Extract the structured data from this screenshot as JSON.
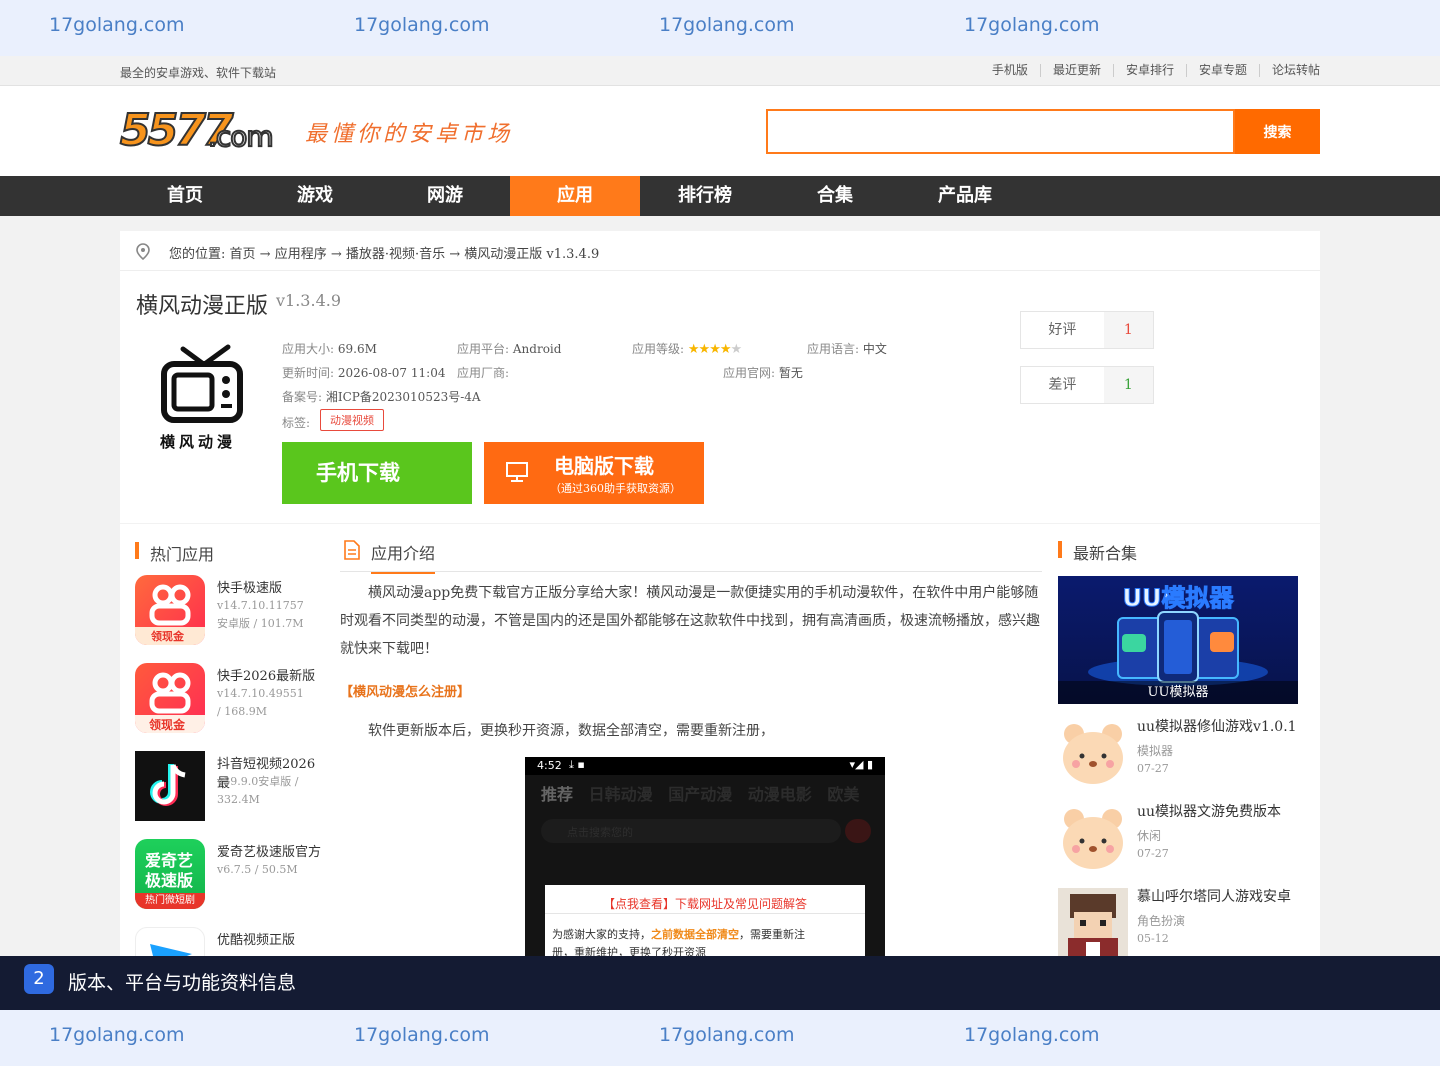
{
  "watermark": {
    "text": "17golang.com"
  },
  "topbar": {
    "slogan": "最全的安卓游戏、软件下载站",
    "links": [
      "手机版",
      "最近更新",
      "安卓排行",
      "安卓专题",
      "论坛转帖"
    ]
  },
  "header": {
    "logo_main": "5577",
    "logo_com": ".com",
    "motto": "最懂你的安卓市场",
    "search_button": "搜索",
    "search_value": ""
  },
  "nav": {
    "items": [
      "首页",
      "游戏",
      "网游",
      "应用",
      "排行榜",
      "合集",
      "产品库"
    ],
    "active": "应用"
  },
  "breadcrumb": {
    "prefix": "您的位置:",
    "path": "首页 → 应用程序 → 播放器·视频·音乐 → 横风动漫正版 v1.3.4.9"
  },
  "app": {
    "title": "横风动漫正版",
    "version": "v1.3.4.9",
    "icon_caption": "横风动漫",
    "size_label": "应用大小:",
    "size": "69.6M",
    "platform_label": "应用平台:",
    "platform": "Android",
    "rating_label": "应用等级:",
    "rating_stars": 4,
    "rating_max": 5,
    "language_label": "应用语言:",
    "language": "中文",
    "updated_label": "更新时间:",
    "updated": "2026-08-07 11:04",
    "vendor_label": "应用厂商:",
    "vendor": "",
    "site_label": "应用官网:",
    "site": "暂无",
    "icp_label": "备案号:",
    "icp": "湘ICP备2023010523号-4A",
    "tags_label": "标签:",
    "tag": "动漫视频"
  },
  "buttons": {
    "phone": "手机下载",
    "pc": "电脑版下载",
    "pc_sub": "（通过360助手获取资源）"
  },
  "votes": {
    "good_label": "好评",
    "good": "1",
    "bad_label": "差评",
    "bad": "1"
  },
  "hot": {
    "title": "热门应用",
    "items": [
      {
        "name": "快手极速版",
        "meta": "v14.7.10.11757安卓版 / 101.7M",
        "badge": "领现金"
      },
      {
        "name": "快手2026最新版",
        "meta": "v14.7.10.49551 / 168.9M",
        "badge": "领现金"
      },
      {
        "name": "抖音短视频2026最",
        "meta": "v39.9.0安卓版 / 332.4M"
      },
      {
        "name": "爱奇艺极速版官方",
        "meta": "v6.7.5 / 50.5M",
        "icon_top": "爱奇艺",
        "icon_mid": "极速版",
        "badge": "热门微短剧"
      },
      {
        "name": "优酷视频正版",
        "meta": ""
      }
    ]
  },
  "intro": {
    "title": "应用介绍",
    "para1": "横风动漫app免费下载官方正版分享给大家！横风动漫是一款便捷实用的手机动漫软件，在软件中用户能够随时观看不同类型的动漫，不管是国内的还是国外都能够在这款软件中找到，拥有高清画质，极速流畅播放，感兴趣就快来下载吧！",
    "subhead": "【横风动漫怎么注册】",
    "para2": "软件更新版本后，更换秒开资源，数据全部清空，需要重新注册，",
    "shot": {
      "time": "4:52",
      "tabs": [
        "推荐",
        "日韩动漫",
        "国产动漫",
        "动漫电影",
        "欧美"
      ],
      "search_hint": "点击搜索您的",
      "dialog_title_a": "【点我查看】",
      "dialog_title_b": "下载网址及常见问题解答",
      "dialog_text_a": "为感谢大家的支持，",
      "dialog_text_b": "之前数据全部清空",
      "dialog_text_c": "，需要重新注",
      "dialog_text_d": "册，重新维护，更换了秒开资源"
    }
  },
  "collections": {
    "title": "最新合集",
    "cover_title": "UU模拟器",
    "cover_caption": "UU模拟器",
    "items": [
      {
        "name": "uu模拟器修仙游戏v1.0.1",
        "cat": "模拟器",
        "date": "07-27"
      },
      {
        "name": "uu模拟器文游免费版本",
        "cat": "休闲",
        "date": "07-27"
      },
      {
        "name": "慕山呼尔塔同人游戏安卓",
        "cat": "角色扮演",
        "date": "05-12"
      }
    ]
  },
  "bottom": {
    "badge": "2",
    "text": "版本、平台与功能资料信息"
  },
  "colors": {
    "accent": "#ff7a1a",
    "nav_bg": "#333333",
    "green": "#5ac61d",
    "bottom_bg": "#141b33"
  }
}
